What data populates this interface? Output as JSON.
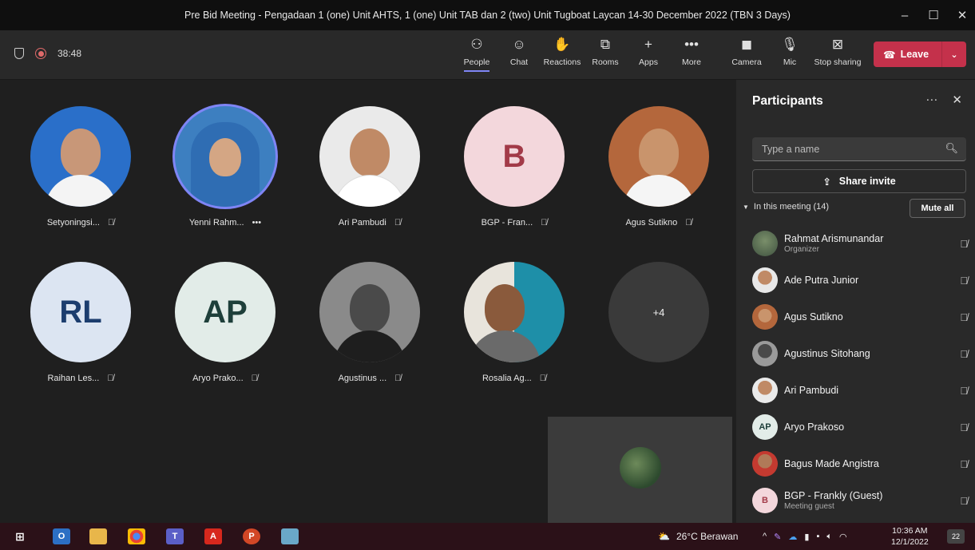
{
  "window": {
    "title": "Pre Bid Meeting - Pengadaan 1 (one) Unit AHTS, 1 (one) Unit TAB dan 2 (two) Unit Tugboat Laycan 14-30 December 2022 (TBN 3 Days)",
    "controls": [
      "–",
      "☐",
      "✕"
    ]
  },
  "toolbar": {
    "timer": "38:48",
    "buttons": [
      {
        "label": "People",
        "icon": "people-icon",
        "glyph": "⚇"
      },
      {
        "label": "Chat",
        "icon": "chat-icon",
        "glyph": "☺"
      },
      {
        "label": "Reactions",
        "icon": "reactions-icon",
        "glyph": "✋"
      },
      {
        "label": "Rooms",
        "icon": "rooms-icon",
        "glyph": "⧉"
      },
      {
        "label": "Apps",
        "icon": "apps-icon",
        "glyph": "+"
      },
      {
        "label": "More",
        "icon": "more-icon",
        "glyph": "•••"
      },
      {
        "label": "Camera",
        "icon": "camera-off-icon",
        "glyph": "◼"
      },
      {
        "label": "Mic",
        "icon": "mic-off-icon",
        "glyph": "🎙"
      },
      {
        "label": "Stop sharing",
        "icon": "stop-sharing-icon",
        "glyph": "⊠"
      }
    ],
    "leave_label": "Leave"
  },
  "gallery": [
    {
      "name": "Setyoningsi...",
      "initials": "",
      "mic_muted": true
    },
    {
      "name": "Yenni Rahm...",
      "initials": "",
      "more": "•••",
      "speaking": true
    },
    {
      "name": "Ari Pambudi",
      "initials": "",
      "mic_muted": true
    },
    {
      "name": "BGP - Fran...",
      "initials": "B",
      "mic_muted": true
    },
    {
      "name": "Agus Sutikno",
      "initials": "",
      "mic_muted": true
    },
    {
      "name": "Raihan Les...",
      "initials": "RL",
      "mic_muted": true
    },
    {
      "name": "Aryo Prako...",
      "initials": "AP",
      "mic_muted": true
    },
    {
      "name": "Agustinus ...",
      "initials": "",
      "mic_muted": true
    },
    {
      "name": "Rosalia Ag...",
      "initials": "",
      "mic_muted": true
    },
    {
      "name": "",
      "initials": "+4"
    }
  ],
  "participants_panel": {
    "title": "Participants",
    "search_placeholder": "Type a name",
    "share_invite": "Share invite",
    "section_label": "In this meeting (14)",
    "mute_all": "Mute all",
    "people": [
      {
        "name": "Rahmat Arismunandar",
        "role": "Organizer",
        "initials": ""
      },
      {
        "name": "Ade Putra Junior",
        "role": "",
        "initials": ""
      },
      {
        "name": "Agus Sutikno",
        "role": "",
        "initials": ""
      },
      {
        "name": "Agustinus Sitohang",
        "role": "",
        "initials": ""
      },
      {
        "name": "Ari Pambudi",
        "role": "",
        "initials": ""
      },
      {
        "name": "Aryo Prakoso",
        "role": "",
        "initials": "AP"
      },
      {
        "name": "Bagus Made Angistra",
        "role": "",
        "initials": ""
      },
      {
        "name": "BGP - Frankly (Guest)",
        "role": "Meeting guest",
        "initials": "B"
      }
    ]
  },
  "taskbar": {
    "weather": "26°C  Berawan",
    "time": "10:36 AM",
    "date": "12/1/2022",
    "notifications": "22"
  },
  "colors": {
    "accent": "#7f85f5",
    "leave": "#c4314b",
    "panel": "#292929",
    "stage": "#1f1f1f"
  }
}
